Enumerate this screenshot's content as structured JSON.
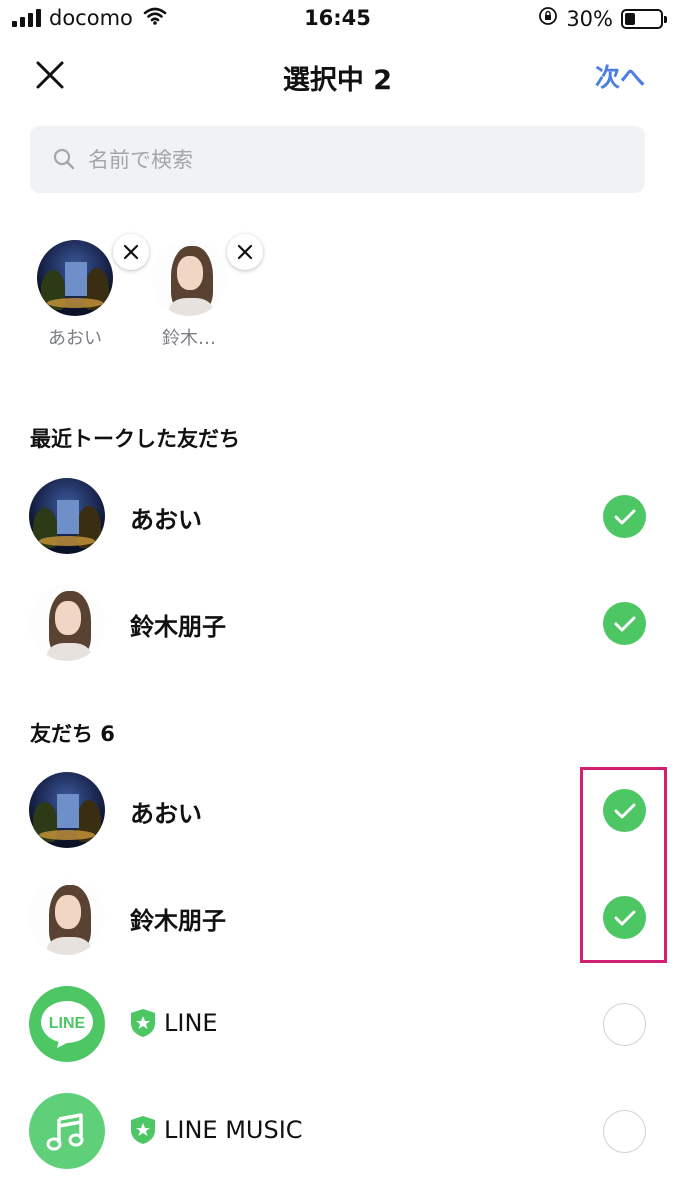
{
  "status_bar": {
    "carrier": "docomo",
    "time": "16:45",
    "battery_percent": "30%",
    "battery_level": 0.3
  },
  "header": {
    "title": "選択中 2",
    "next_label": "次へ",
    "close_icon": "close-icon"
  },
  "search": {
    "placeholder": "名前で検索",
    "value": ""
  },
  "selected": [
    {
      "name": "あおい",
      "avatar": "night-house"
    },
    {
      "name": "鈴木…",
      "avatar": "woman"
    }
  ],
  "recent_section": {
    "title": "最近トークした友だち",
    "items": [
      {
        "name": "あおい",
        "checked": true
      },
      {
        "name": "鈴木朋子",
        "checked": true
      }
    ]
  },
  "friends_section": {
    "title": "友だち 6",
    "items": [
      {
        "name": "あおい",
        "checked": true
      },
      {
        "name": "鈴木朋子",
        "checked": true
      },
      {
        "name": "LINE",
        "checked": false,
        "official": true,
        "logo_text": "LINE"
      },
      {
        "name": "LINE MUSIC",
        "checked": false,
        "official": true
      }
    ]
  },
  "colors": {
    "accent_blue": "#4c7ee2",
    "check_green": "#4cc764",
    "highlight_pink": "#d1206f"
  }
}
